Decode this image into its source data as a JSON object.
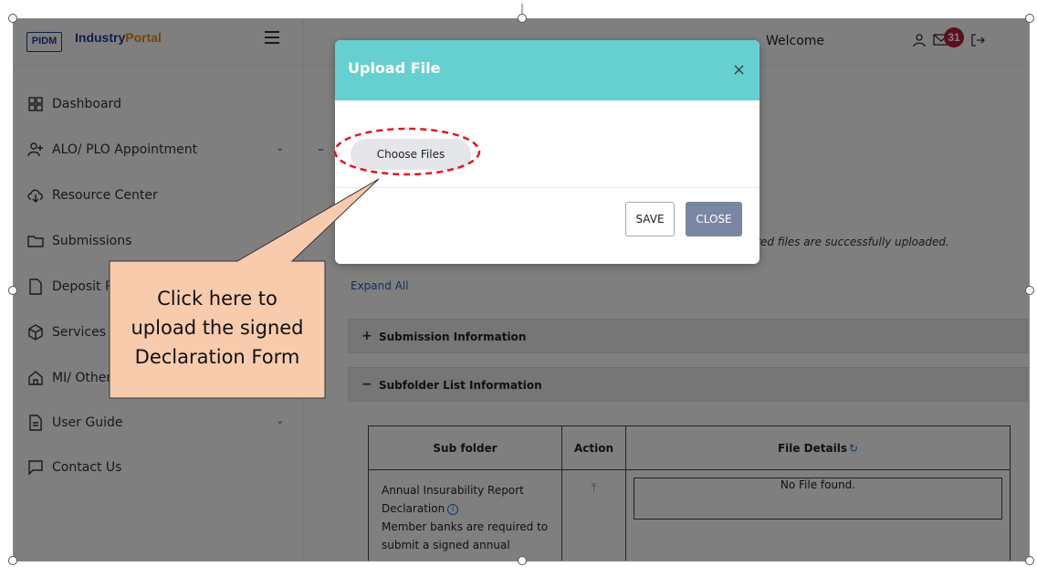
{
  "brand": {
    "logo_text": "PIDM",
    "name_part1": "Industry",
    "name_part2": "Portal",
    "colors": {
      "primary": "#1d3f8f",
      "accent": "#e08a1e"
    }
  },
  "sidebar": {
    "items": [
      {
        "label": "Dashboard",
        "icon": "grid-icon",
        "has_chevron": false
      },
      {
        "label": "ALO/ PLO Appointment",
        "icon": "user-plus-icon",
        "has_chevron": true
      },
      {
        "label": "Resource Center",
        "icon": "cloud-download-icon",
        "has_chevron": false
      },
      {
        "label": "Submissions",
        "icon": "folder-icon",
        "has_chevron": true
      },
      {
        "label": "Deposit P",
        "icon": "file-icon",
        "has_chevron": false
      },
      {
        "label": "Services R",
        "icon": "cube-icon",
        "has_chevron": false
      },
      {
        "label": "MI/ Other",
        "icon": "home-icon",
        "has_chevron": false
      },
      {
        "label": "User Guide",
        "icon": "document-icon",
        "has_chevron": true
      },
      {
        "label": "Contact Us",
        "icon": "chat-icon",
        "has_chevron": false
      }
    ]
  },
  "header": {
    "welcome": "Welcome",
    "notification_count": "31",
    "badge_color": "#b71e3b"
  },
  "content": {
    "dash_glyph": "–",
    "uploaded_note": "red files are successfully uploaded.",
    "expand_all": "Expand All",
    "sections": [
      {
        "sign": "+",
        "title": "Submission Information"
      },
      {
        "sign": "−",
        "title": "Subfolder List Information"
      }
    ],
    "table": {
      "headers": {
        "sub_folder": "Sub folder",
        "action": "Action",
        "file_details": "File Details"
      },
      "row": {
        "line1": "Annual Insurability Report",
        "line2": "Declaration",
        "line3": "Member banks are required to",
        "line4": "submit a signed annual",
        "no_file": "No File found."
      }
    }
  },
  "modal": {
    "title": "Upload File",
    "choose_files": "Choose Files",
    "save": "SAVE",
    "close": "CLOSE",
    "header_color": "#66d0d0"
  },
  "annotation": {
    "lines": [
      "Click here to",
      "upload the signed",
      "Declaration Form"
    ],
    "fill": "#f8cbad",
    "highlight": "#e8141c"
  }
}
